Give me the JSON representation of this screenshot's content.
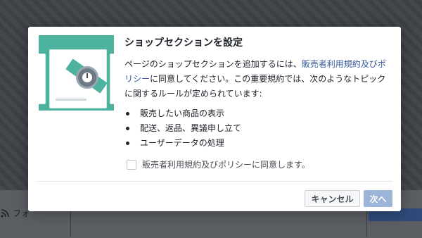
{
  "background": {
    "follow_label": "フォ"
  },
  "dialog": {
    "title": "ショップセクションを設定",
    "body_part1": "ページのショップセクションを追加するには、",
    "body_link": "販売者利用規約及びポリシー",
    "body_part2": "に同意してください。この重要規約では、次のようなトピックに関するルールが定められています:",
    "bullets": [
      "販売したい商品の表示",
      "配送、返品、異議申し立て",
      "ユーザーデータの処理"
    ],
    "agree_label": "販売者利用規約及びポリシーに同意します。",
    "agree_checked": false,
    "cancel_label": "キャンセル",
    "next_label": "次へ"
  },
  "colors": {
    "illustration_bg": "#4db39e",
    "link": "#365899",
    "primary_disabled": "#9cb4d8"
  }
}
